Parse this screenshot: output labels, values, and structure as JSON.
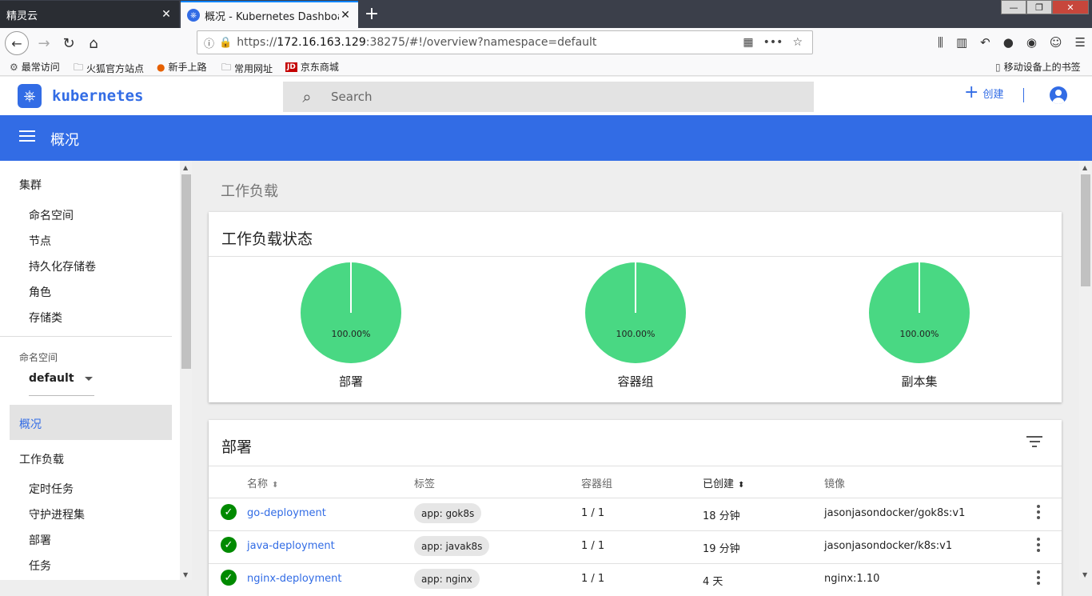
{
  "browser": {
    "tabs": [
      {
        "title": "精灵云",
        "close": "✕"
      },
      {
        "title": "概况 - Kubernetes Dashboard",
        "close": "✕"
      }
    ],
    "new_tab": "+",
    "window_controls": {
      "minimize": "—",
      "restore": "❐",
      "close": "✕"
    },
    "url": {
      "scheme": "https://",
      "host": "172.16.163.129",
      "rest": ":38275/#!/overview?namespace=default"
    },
    "bookmarks": [
      {
        "label": "最常访问",
        "icon": "gear-icon"
      },
      {
        "label": "火狐官方站点",
        "icon": "folder-icon"
      },
      {
        "label": "新手上路",
        "icon": "firefox-icon"
      },
      {
        "label": "常用网址",
        "icon": "folder-icon"
      },
      {
        "label": "京东商城",
        "icon": "jd-icon",
        "badge": "JD"
      },
      {
        "label": "移动设备上的书签",
        "icon": "mobile-icon"
      }
    ]
  },
  "app": {
    "logo_text": "kubernetes",
    "search_placeholder": "Search",
    "create_label": "创建",
    "page_title": "概况",
    "accent_color": "#326ce5"
  },
  "sidebar": {
    "cluster_header": "集群",
    "cluster_items": [
      "命名空间",
      "节点",
      "持久化存储卷",
      "角色",
      "存储类"
    ],
    "namespace_label": "命名空间",
    "namespace_value": "default",
    "overview": "概况",
    "workloads_header": "工作负载",
    "workload_items": [
      "定时任务",
      "守护进程集",
      "部署",
      "任务"
    ]
  },
  "main": {
    "section_title": "工作负载",
    "status_card": {
      "title": "工作负载状态",
      "charts": [
        {
          "label": "部署",
          "percent_text": "100.00%",
          "percent": 100
        },
        {
          "label": "容器组",
          "percent_text": "100.00%",
          "percent": 100
        },
        {
          "label": "副本集",
          "percent_text": "100.00%",
          "percent": 100
        }
      ],
      "pie_color": "#49d883"
    },
    "deploy_card": {
      "title": "部署",
      "columns": [
        "名称",
        "标签",
        "容器组",
        "已创建",
        "镜像"
      ],
      "rows": [
        {
          "name": "go-deployment",
          "label": "app: gok8s",
          "pods": "1 / 1",
          "created": "18 分钟",
          "image": "jasonjasondocker/gok8s:v1"
        },
        {
          "name": "java-deployment",
          "label": "app: javak8s",
          "pods": "1 / 1",
          "created": "19 分钟",
          "image": "jasonjasondocker/k8s:v1"
        },
        {
          "name": "nginx-deployment",
          "label": "app: nginx",
          "pods": "1 / 1",
          "created": "4 天",
          "image": "nginx:1.10"
        }
      ]
    }
  }
}
